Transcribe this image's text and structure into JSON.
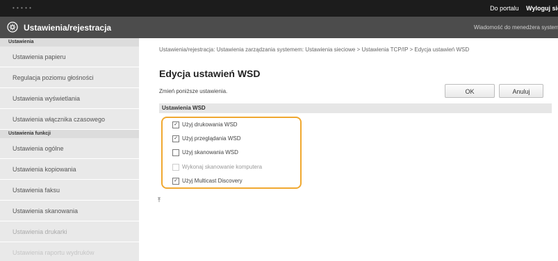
{
  "topbar": {
    "model_text": "• • • • •",
    "link_portal": "Do portalu",
    "link_logout": "Wyloguj się"
  },
  "titlebar": {
    "title": "Ustawienia/rejestracja",
    "message": "Wiadomość do menedżera systemu"
  },
  "sidebar": {
    "groups": [
      {
        "heading": "Ustawienia",
        "items": [
          "Ustawienia papieru",
          "Regulacja poziomu głośności",
          "Ustawienia wyświetlania",
          "Ustawienia włącznika czasowego"
        ]
      },
      {
        "heading": "Ustawienia funkcji",
        "items": [
          "Ustawienia ogólne",
          "Ustawienia kopiowania",
          "Ustawienia faksu",
          "Ustawienia skanowania",
          "Ustawienia drukarki",
          "Ustawienia raportu wydruków"
        ]
      }
    ]
  },
  "main": {
    "breadcrumb": "Ustawienia/rejestracja: Ustawienia zarządzania systemem: Ustawienia sieciowe > Ustawienia TCP/IP > Edycja ustawień WSD",
    "page_title": "Edycja ustawień WSD",
    "instruction": "Zmień poniższe ustawienia.",
    "ok_label": "OK",
    "cancel_label": "Anuluj",
    "section_title": "Ustawienia WSD",
    "options": [
      {
        "label": "Użyj drukowania WSD",
        "checked": true,
        "disabled": false
      },
      {
        "label": "Użyj przeglądania WSD",
        "checked": true,
        "disabled": false
      },
      {
        "label": "Użyj skanowania WSD",
        "checked": false,
        "disabled": false
      },
      {
        "label": "Wykonaj skanowanie komputera",
        "checked": false,
        "disabled": true
      },
      {
        "label": "Użyj Multicast Discovery",
        "checked": true,
        "disabled": false
      }
    ],
    "top_icon": "⤒"
  },
  "colors": {
    "highlight": "#f0a830",
    "topbar": "#1c1c1c",
    "titlebar": "#4c4c4c",
    "sidebar": "#e9e9e9"
  }
}
